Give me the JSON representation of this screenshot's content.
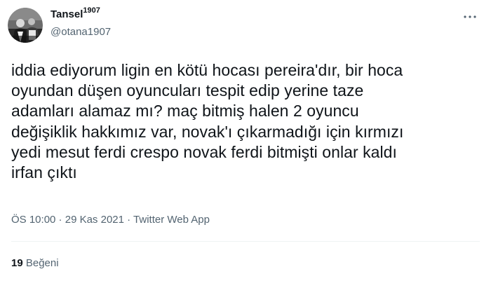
{
  "author": {
    "display_name": "Tansel",
    "display_name_superscript": "1907",
    "handle": "@otana1907"
  },
  "tweet": {
    "text": "iddia ediyorum ligin en kötü hocası pereira'dır, bir hoca\noyundan düşen oyuncuları tespit edip yerine taze\nadamları alamaz mı? maç bitmiş halen 2 oyuncu\ndeğişiklik hakkımız var, novak'ı çıkarmadığı için kırmızı\nyedi mesut ferdi crespo novak ferdi bitmişti onlar kaldı\nirfan çıktı"
  },
  "meta": {
    "time": "ÖS 10:00",
    "separator1": " · ",
    "date": "29 Kas 2021",
    "separator2": " · ",
    "source": "Twitter Web App"
  },
  "stats": {
    "likes_count": "19",
    "likes_label": "Beğeni"
  },
  "icons": {
    "more": "more-horizontal-icon",
    "avatar": "profile-avatar"
  },
  "colors": {
    "text_primary": "#0f1419",
    "text_secondary": "#536471",
    "divider": "#eff3f4"
  }
}
